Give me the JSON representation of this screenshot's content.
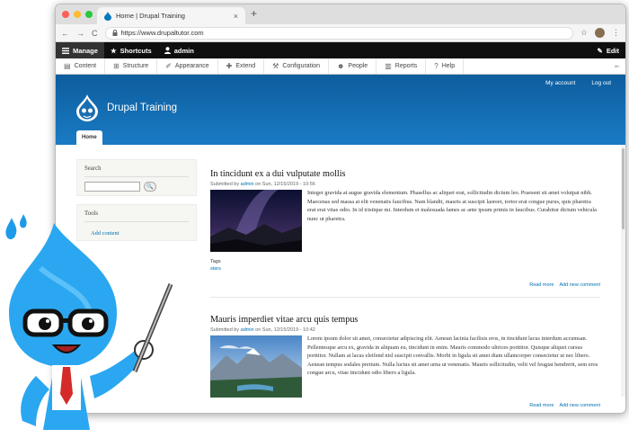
{
  "browser": {
    "tab_title": "Home | Drupal Training",
    "tab_close": "×",
    "new_tab": "+",
    "url": "https://www.drupaltutor.com",
    "nav_back": "←",
    "nav_forward": "→",
    "nav_reload": "C",
    "menu": "⋮",
    "star": "☆"
  },
  "toolbar": {
    "manage": "Manage",
    "shortcuts": "Shortcuts",
    "user": "admin",
    "edit": "Edit"
  },
  "tray": {
    "items": [
      {
        "label": "Content",
        "icon": "content-icon"
      },
      {
        "label": "Structure",
        "icon": "structure-icon"
      },
      {
        "label": "Appearance",
        "icon": "appearance-icon"
      },
      {
        "label": "Extend",
        "icon": "extend-icon"
      },
      {
        "label": "Configuration",
        "icon": "configuration-icon"
      },
      {
        "label": "People",
        "icon": "people-icon"
      },
      {
        "label": "Reports",
        "icon": "reports-icon"
      },
      {
        "label": "Help",
        "icon": "help-icon"
      }
    ]
  },
  "header": {
    "my_account": "My account",
    "log_out": "Log out",
    "site_name": "Drupal Training",
    "home_tab": "Home"
  },
  "sidebar": {
    "search_title": "Search",
    "search_button": "🔍",
    "tools_title": "Tools",
    "add_content": "Add content"
  },
  "articles": [
    {
      "title": "In tincidunt ex a dui vulputate mollis",
      "submitted_prefix": "Submitted by",
      "author": "admin",
      "date": "on Sun, 12/15/2019 - 10:56",
      "body": "Integer gravida at augue gravida elementum. Phasellus ac aliquet erat, sollicitudin dictum leo. Praesent sit amet volutpat nibh. Maecenas sed massa at elit venenatis faucibus. Nam blandit, mauris at suscipit laoreet, tortor erat congue purus, quis pharetra erat erat vitae odio. In id tristique mi. Interdum et malesuada fames ac ante ipsum primis in faucibus. Curabitur dictum vehicula nunc ut pharetra.",
      "tags_label": "Tags",
      "tag": "stars",
      "read_more": "Read more",
      "add_comment": "Add new comment"
    },
    {
      "title": "Mauris imperdiet vitae arcu quis tempus",
      "submitted_prefix": "Submitted by",
      "author": "admin",
      "date": "on Sun, 12/15/2019 - 10:42",
      "body": "Lorem ipsum dolor sit amet, consectetur adipiscing elit. Aenean lacinia facilisis eros, in tincidunt lacus interdum accumsan. Pellentesque arcu ex, gravida in aliquam eu, tincidunt in enim. Mauris commodo ultrices porttitor. Quisque aliquet cursus porttitor. Nullam at lacus eleifend nisl suscipit convallis. Morbi in ligula sit amet diam ullamcorper consectetur ut nec libero. Aenean tempus sodales pretium. Nulla luctus sit amet urna ut venenatis. Mauris sollicitudin, velit vel feugiat hendrerit, sem eros congue arcu, vitae tincidunt odio libero a ligula.",
      "read_more": "Read more",
      "add_comment": "Add new comment"
    }
  ],
  "colors": {
    "header_blue": "#0d5d9e",
    "link_blue": "#0071b3",
    "toolbar_black": "#0f0f0f"
  }
}
